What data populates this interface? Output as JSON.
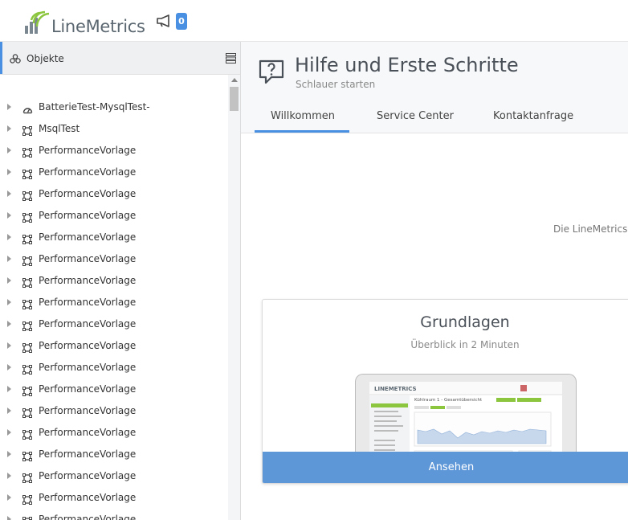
{
  "header": {
    "logo_text": "LineMetrics",
    "notification_count": "0"
  },
  "sidebar": {
    "title": "Objekte",
    "items": [
      {
        "label": "BatterieTest-MysqlTest-",
        "icon": "gauge-icon"
      },
      {
        "label": "MsqlTest",
        "icon": "object-icon"
      },
      {
        "label": "PerformanceVorlage",
        "icon": "object-icon"
      },
      {
        "label": "PerformanceVorlage",
        "icon": "object-icon"
      },
      {
        "label": "PerformanceVorlage",
        "icon": "object-icon"
      },
      {
        "label": "PerformanceVorlage",
        "icon": "object-icon"
      },
      {
        "label": "PerformanceVorlage",
        "icon": "object-icon"
      },
      {
        "label": "PerformanceVorlage",
        "icon": "object-icon"
      },
      {
        "label": "PerformanceVorlage",
        "icon": "object-icon"
      },
      {
        "label": "PerformanceVorlage",
        "icon": "object-icon"
      },
      {
        "label": "PerformanceVorlage",
        "icon": "object-icon"
      },
      {
        "label": "PerformanceVorlage",
        "icon": "object-icon"
      },
      {
        "label": "PerformanceVorlage",
        "icon": "object-icon"
      },
      {
        "label": "PerformanceVorlage",
        "icon": "object-icon"
      },
      {
        "label": "PerformanceVorlage",
        "icon": "object-icon"
      },
      {
        "label": "PerformanceVorlage",
        "icon": "object-icon"
      },
      {
        "label": "PerformanceVorlage",
        "icon": "object-icon"
      },
      {
        "label": "PerformanceVorlage",
        "icon": "object-icon"
      },
      {
        "label": "PerformanceVorlage",
        "icon": "object-icon"
      },
      {
        "label": "PerformanceVorlage",
        "icon": "object-icon"
      }
    ]
  },
  "main": {
    "title": "Hilfe und Erste Schritte",
    "subtitle": "Schlauer starten",
    "tabs": [
      {
        "label": "Willkommen",
        "active": true
      },
      {
        "label": "Service Center",
        "active": false
      },
      {
        "label": "Kontaktanfrage",
        "active": false
      }
    ],
    "intro_text": "Die LineMetrics",
    "card": {
      "title": "Grundlagen",
      "subtitle": "Überblick in 2 Minuten",
      "button_label": "Ansehen",
      "preview": {
        "logo": "LINEMETRICS",
        "heading": "Kühlraum 1 - Gesamtübersicht"
      }
    }
  },
  "colors": {
    "accent": "#4a90e2",
    "button": "#5e97d8",
    "brand_green": "#8cc63f"
  }
}
